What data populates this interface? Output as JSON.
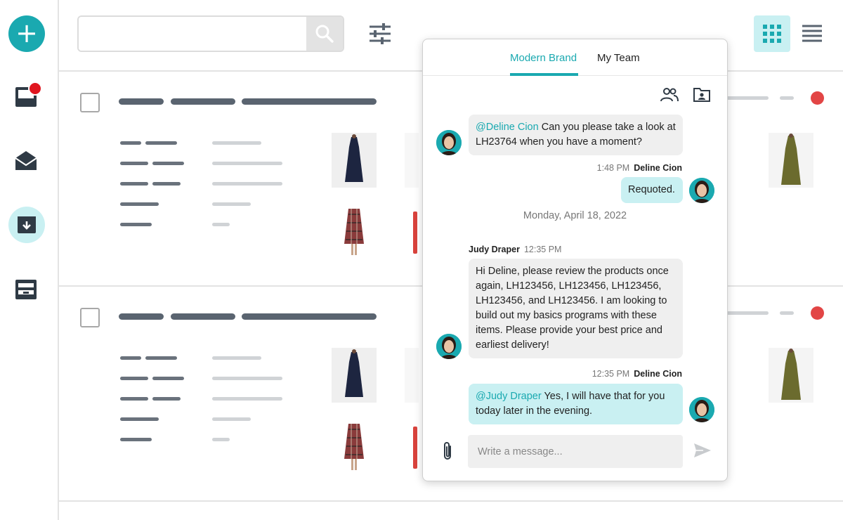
{
  "sidebar": {
    "items": [
      {
        "icon": "plus-icon",
        "glyph": "+"
      },
      {
        "icon": "inbox-icon",
        "has_notification": true
      },
      {
        "icon": "open-mail-icon"
      },
      {
        "icon": "archive-download-icon",
        "active": true
      },
      {
        "icon": "tray-stack-icon"
      }
    ]
  },
  "toolbar": {
    "search_value": "",
    "search_placeholder": "",
    "view_modes": [
      "grid-view",
      "list-view"
    ],
    "active_view": "grid-view"
  },
  "colors": {
    "accent": "#1aa9b0",
    "accent_light": "#c9f0f2",
    "notification": "#e0161f",
    "status_dot": "#e24545"
  },
  "chat": {
    "tabs": [
      {
        "label": "Modern Brand",
        "active": true
      },
      {
        "label": "My Team",
        "active": false
      }
    ],
    "tools": [
      "people-icon",
      "contact-folder-icon"
    ],
    "messages": [
      {
        "direction": "in",
        "mention": "@Deline Cion",
        "text": " Can you please take a look at LH23764 when you have a moment?"
      },
      {
        "direction": "out",
        "time": "1:48 PM",
        "sender": "Deline Cion",
        "text": "Requoted."
      },
      {
        "direction": "in",
        "sender": "Judy Draper",
        "time": "12:35 PM",
        "text": "Hi Deline, please review the products once again, LH123456, LH123456, LH123456, LH123456, and LH123456. I am looking to build out my basics programs with these items. Please provide your best price and earliest delivery!"
      },
      {
        "direction": "out",
        "time": "12:35 PM",
        "sender": "Deline Cion",
        "mention": "@Judy Draper",
        "text": " Yes, I will have that for you today later in the evening."
      }
    ],
    "date_separator": "Monday, April 18, 2022",
    "composer": {
      "placeholder": "Write a message...",
      "value": ""
    },
    "actions": [
      "paperclip-icon",
      "send-icon"
    ]
  }
}
